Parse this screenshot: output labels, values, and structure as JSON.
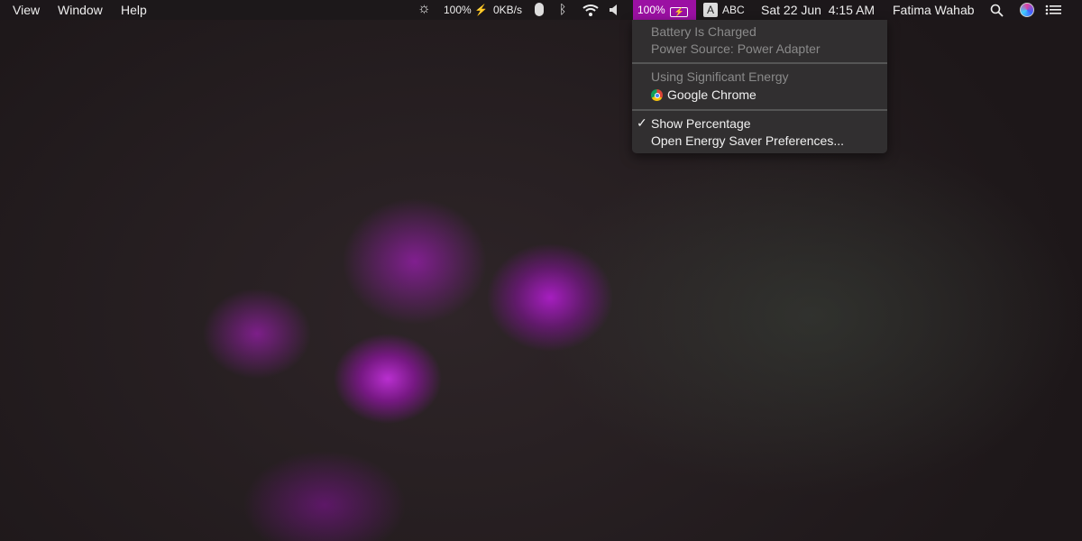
{
  "menubar": {
    "left": [
      "View",
      "Window",
      "Help"
    ],
    "cpu": "100%",
    "cpu_icon": "bolt-icon",
    "network": "0KB/s",
    "battery": "100%",
    "input_source_letter": "A",
    "input_source": "ABC",
    "datetime": "Sat 22 Jun  4:15 AM",
    "user": "Fatima Wahab",
    "accent": "#9b10a3"
  },
  "battery_menu": {
    "status": "Battery Is Charged",
    "power_source": "Power Source: Power Adapter",
    "energy_header": "Using Significant Energy",
    "energy_app": "Google Chrome",
    "show_percentage": "Show Percentage",
    "show_percentage_checked": "✓",
    "open_prefs": "Open Energy Saver Preferences..."
  }
}
